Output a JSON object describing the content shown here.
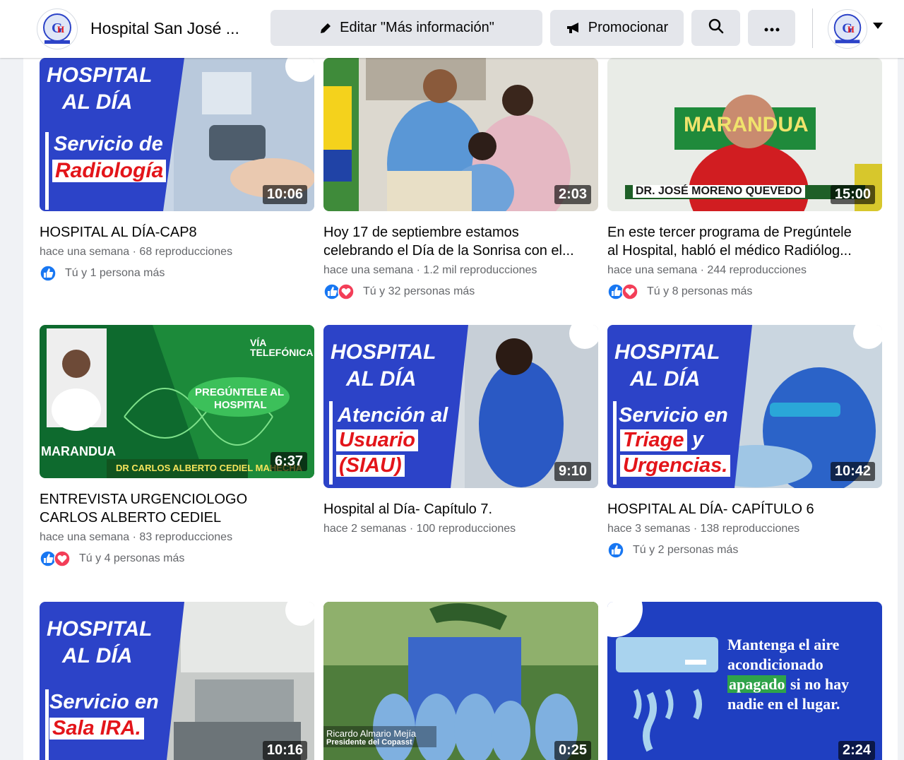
{
  "topbar": {
    "page_name": "Hospital San José ...",
    "edit_button": "Editar \"Más información\"",
    "promote_button": "Promocionar",
    "icons": [
      "pencil-icon",
      "megaphone-icon",
      "search-icon",
      "more-icon",
      "chevron-down-icon"
    ]
  },
  "colors": {
    "fb_blue": "#1877f2",
    "love_red": "#f33e58",
    "hospital_blue": "#2c43c8",
    "hospital_red": "#e3151a",
    "muted_text": "#65676b"
  },
  "videos": [
    {
      "title_lines": [
        "HOSPITAL AL DÍA-CAP8"
      ],
      "time": "hace una semana",
      "views": "68 reproducciones",
      "reactions": "Tú y 1 persona más",
      "reaction_icons": [
        "like"
      ],
      "duration": "10:06",
      "thumb": {
        "line1": "HOSPITAL",
        "line2": "AL DÍA",
        "line3": "Servicio de",
        "line4": "Radiología"
      }
    },
    {
      "title_lines": [
        "Hoy 17 de septiembre estamos",
        "celebrando el Día de la Sonrisa con el..."
      ],
      "time": "hace una semana",
      "views": "1.2 mil reproducciones",
      "reactions": "Tú y 32 personas más",
      "reaction_icons": [
        "like",
        "love"
      ],
      "duration": "2:03"
    },
    {
      "title_lines": [
        "En este tercer programa de Pregúntele",
        "al Hospital, habló el médico Radiólog..."
      ],
      "time": "hace una semana",
      "views": "244 reproducciones",
      "reactions": "Tú y 8 personas más",
      "reaction_icons": [
        "like",
        "love"
      ],
      "duration": "15:00",
      "thumb": {
        "caption": "DR. JOSÉ MORENO QUEVEDO",
        "sign": "MARANDUA"
      }
    },
    {
      "title_lines": [
        "ENTREVISTA URGENCIOLOGO",
        "CARLOS ALBERTO CEDIEL"
      ],
      "time": "hace una semana",
      "views": "83 reproducciones",
      "reactions": "Tú y 4 personas más",
      "reaction_icons": [
        "like",
        "love"
      ],
      "duration": "6:37",
      "thumb": {
        "tag": "VÍA TELEFÓNICA",
        "bubble1": "PREGÚNTELE AL",
        "bubble2": "HOSPITAL",
        "brand": "MARANDUA",
        "caption": "DR CARLOS ALBERTO CEDIEL MAHECHA"
      }
    },
    {
      "title_lines": [
        "Hospital al Día- Capítulo 7."
      ],
      "time": "hace 2 semanas",
      "views": "100 reproducciones",
      "reactions": "",
      "reaction_icons": [],
      "duration": "9:10",
      "thumb": {
        "line1": "HOSPITAL",
        "line2": "AL DÍA",
        "line3": "Atención al",
        "line4": "Usuario",
        "line5": "(SIAU)"
      }
    },
    {
      "title_lines": [
        "HOSPITAL AL DÍA- CAPÍTULO 6"
      ],
      "time": "hace 3 semanas",
      "views": "138 reproducciones",
      "reactions": "Tú y 2 personas más",
      "reaction_icons": [
        "like"
      ],
      "duration": "10:42",
      "thumb": {
        "line1": "HOSPITAL",
        "line2": "AL DÍA",
        "line3": "Servicio en",
        "line4": "Triage",
        "line4b": "y",
        "line5": "Urgencias."
      }
    },
    {
      "title_lines": [],
      "duration": "10:16",
      "thumb": {
        "line1": "HOSPITAL",
        "line2": "AL DÍA",
        "line3": "Servicio en",
        "line4": "Sala IRA."
      }
    },
    {
      "title_lines": [],
      "duration": "0:25",
      "thumb": {
        "caption1": "Ricardo Almario Mejía",
        "caption2": "Presidente del Copasst"
      }
    },
    {
      "title_lines": [],
      "duration": "2:24",
      "thumb": {
        "msg1": "Mantenga el aire",
        "msg2": "acondicionado",
        "msg3": "apagado",
        "msg3b": " si no hay",
        "msg4": "nadie en el lugar."
      }
    }
  ]
}
